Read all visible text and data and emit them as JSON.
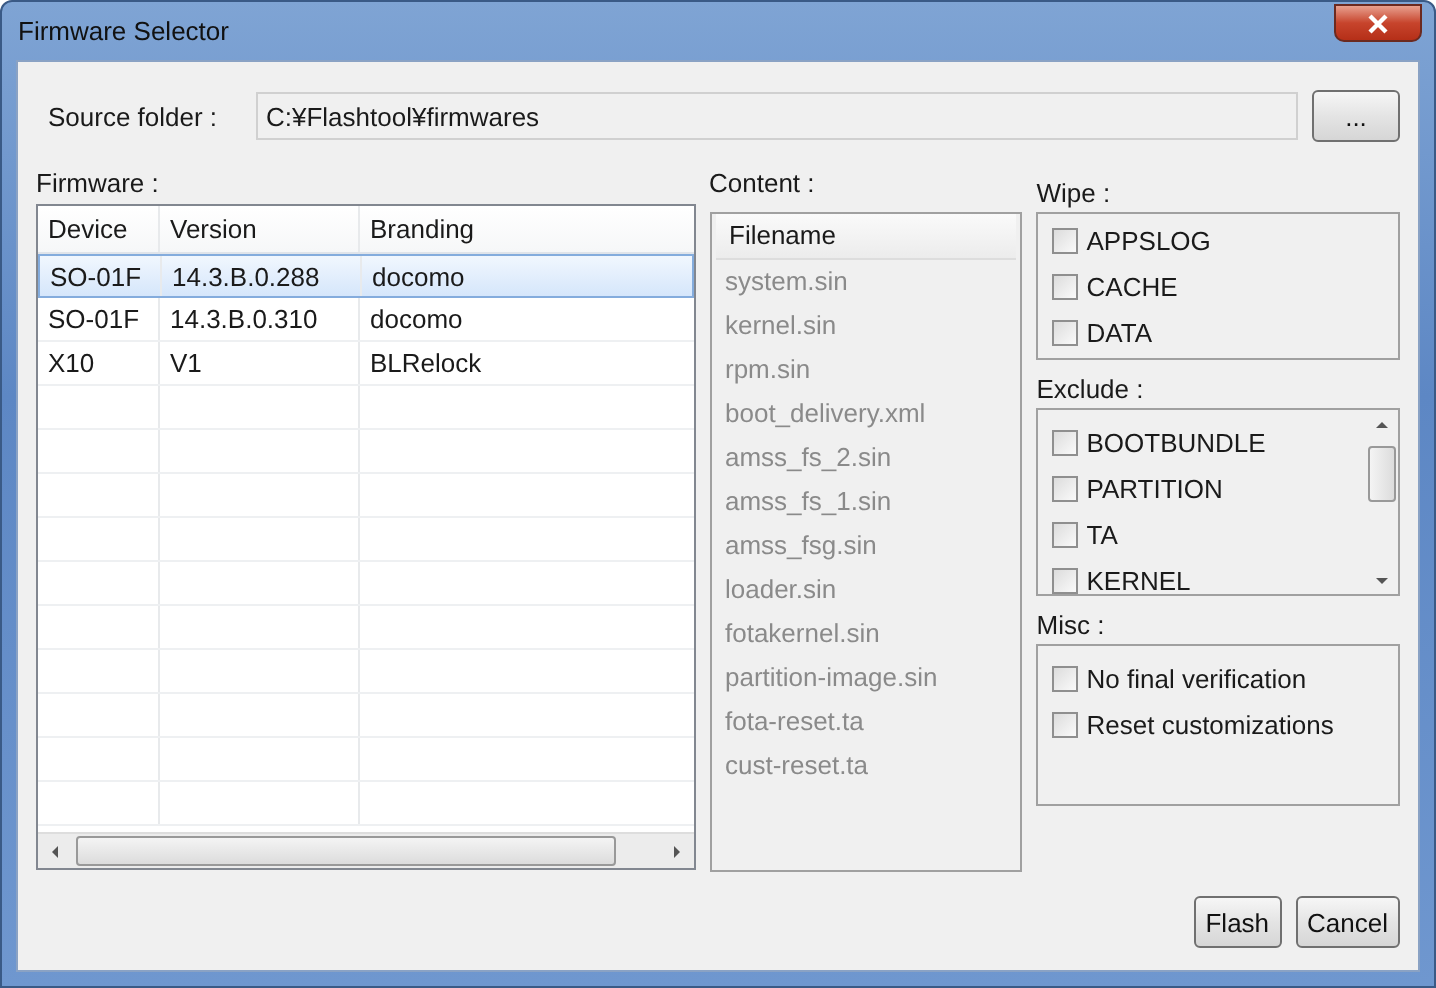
{
  "window": {
    "title": "Firmware Selector"
  },
  "source_folder": {
    "label": "Source folder :",
    "value": "C:¥Flashtool¥firmwares",
    "browse_button": "..."
  },
  "firmware": {
    "label": "Firmware :",
    "columns": [
      "Device",
      "Version",
      "Branding"
    ],
    "rows": [
      {
        "cells": [
          "SO-01F",
          "14.3.B.0.288",
          "docomo"
        ],
        "selected": true
      },
      {
        "cells": [
          "SO-01F",
          "14.3.B.0.310",
          "docomo"
        ],
        "selected": false
      },
      {
        "cells": [
          "X10",
          "V1",
          "BLRelock"
        ],
        "selected": false
      }
    ]
  },
  "content": {
    "label": "Content :",
    "header": "Filename",
    "files": [
      "system.sin",
      "kernel.sin",
      "rpm.sin",
      "boot_delivery.xml",
      "amss_fs_2.sin",
      "amss_fs_1.sin",
      "amss_fsg.sin",
      "loader.sin",
      "fotakernel.sin",
      "partition-image.sin",
      "fota-reset.ta",
      "cust-reset.ta"
    ]
  },
  "wipe": {
    "label": "Wipe :",
    "options": [
      {
        "label": "APPSLOG",
        "checked": false
      },
      {
        "label": "CACHE",
        "checked": false
      },
      {
        "label": "DATA",
        "checked": false
      }
    ]
  },
  "exclude": {
    "label": "Exclude :",
    "options": [
      {
        "label": "BOOTBUNDLE",
        "checked": false
      },
      {
        "label": "PARTITION",
        "checked": false
      },
      {
        "label": "TA",
        "checked": false
      },
      {
        "label": "KERNEL",
        "checked": false
      }
    ]
  },
  "misc": {
    "label": "Misc :",
    "options": [
      {
        "label": "No final verification",
        "checked": false
      },
      {
        "label": "Reset customizations",
        "checked": false
      }
    ]
  },
  "buttons": [
    "Flash",
    "Cancel"
  ]
}
